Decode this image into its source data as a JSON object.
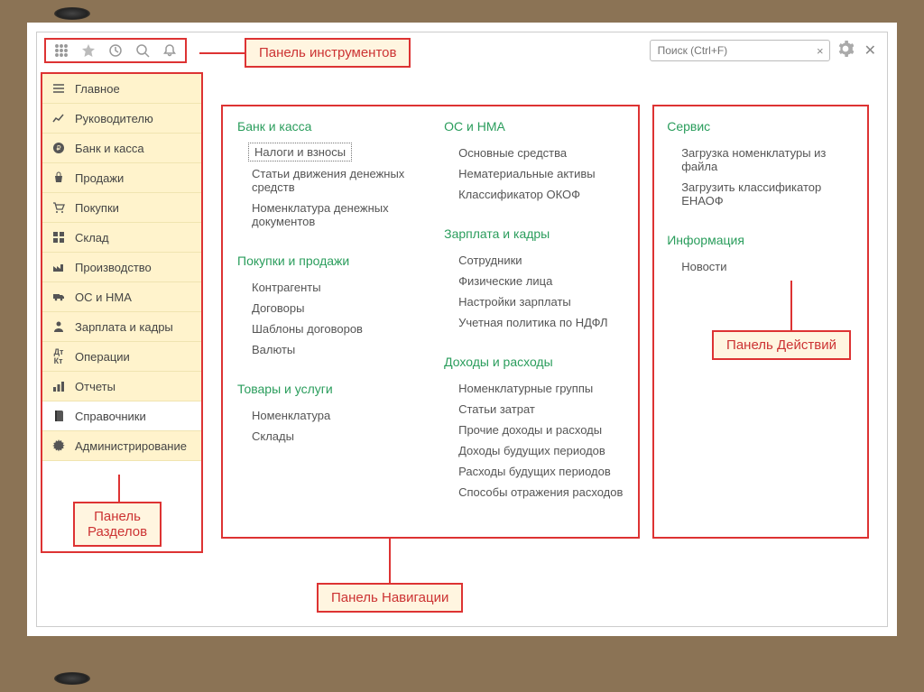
{
  "toolbar": {},
  "search": {
    "placeholder": "Поиск (Ctrl+F)"
  },
  "sidebar": {
    "items": [
      {
        "label": "Главное"
      },
      {
        "label": "Руководителю"
      },
      {
        "label": "Банк и касса"
      },
      {
        "label": "Продажи"
      },
      {
        "label": "Покупки"
      },
      {
        "label": "Склад"
      },
      {
        "label": "Производство"
      },
      {
        "label": "ОС и НМА"
      },
      {
        "label": "Зарплата и кадры"
      },
      {
        "label": "Операции"
      },
      {
        "label": "Отчеты"
      },
      {
        "label": "Справочники"
      },
      {
        "label": "Администрирование"
      }
    ]
  },
  "nav": {
    "col1": [
      {
        "title": "Банк и касса",
        "items": [
          "Налоги и взносы",
          "Статьи движения денежных средств",
          "Номенклатура денежных документов"
        ],
        "highlightFirst": true
      },
      {
        "title": "Покупки и продажи",
        "items": [
          "Контрагенты",
          "Договоры",
          "Шаблоны договоров",
          "Валюты"
        ]
      },
      {
        "title": "Товары и услуги",
        "items": [
          "Номенклатура",
          "Склады"
        ]
      }
    ],
    "col2": [
      {
        "title": "ОС и НМА",
        "items": [
          "Основные средства",
          "Нематериальные активы",
          "Классификатор ОКОФ"
        ]
      },
      {
        "title": "Зарплата и кадры",
        "items": [
          "Сотрудники",
          "Физические лица",
          "Настройки зарплаты",
          "Учетная политика по НДФЛ"
        ]
      },
      {
        "title": "Доходы и расходы",
        "items": [
          "Номенклатурные группы",
          "Статьи затрат",
          "Прочие доходы и расходы",
          "Доходы будущих периодов",
          "Расходы будущих периодов",
          "Способы отражения расходов"
        ]
      }
    ]
  },
  "actions": [
    {
      "title": "Сервис",
      "items": [
        "Загрузка номенклатуры из файла",
        "Загрузить классификатор ЕНАОФ"
      ]
    },
    {
      "title": "Информация",
      "items": [
        "Новости"
      ]
    }
  ],
  "callouts": {
    "toolbar": "Панель инструментов",
    "sections": "Панель\nРазделов",
    "navigation": "Панель Навигации",
    "actions": "Панель Действий"
  }
}
